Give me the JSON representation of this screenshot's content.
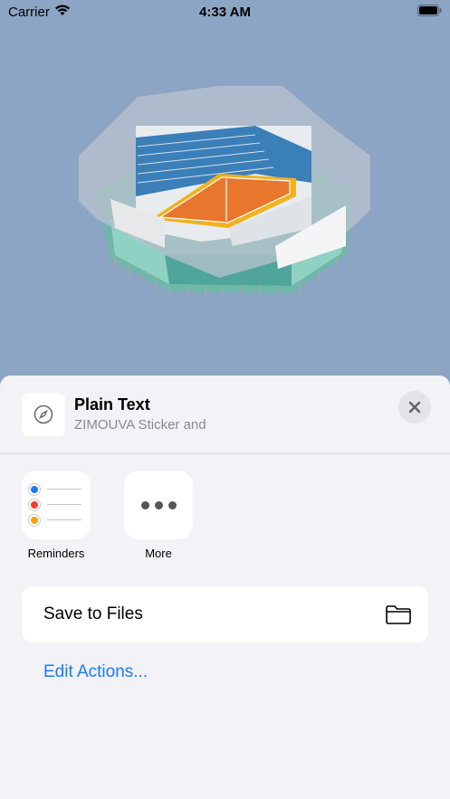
{
  "status_bar": {
    "carrier": "Carrier",
    "time": "4:33 AM"
  },
  "hero": {
    "image_icon": "stadium-illustration"
  },
  "sheet": {
    "title": "Plain Text",
    "subtitle": "ZIMOUVA Sticker and",
    "thumb_icon": "compass-icon",
    "close_icon": "close-icon"
  },
  "share_apps": [
    {
      "label": "Reminders",
      "icon": "reminders-icon",
      "dot_colors": [
        "#1a7cf5",
        "#ff3b30",
        "#ff9f0a"
      ]
    },
    {
      "label": "More",
      "icon": "more-icon"
    }
  ],
  "actions": {
    "save_to_files": "Save to Files",
    "save_icon": "folder-icon",
    "edit_actions": "Edit Actions..."
  },
  "colors": {
    "background": "#8ca5c4",
    "sheet": "#f2f2f7",
    "link": "#1a7cf5"
  }
}
